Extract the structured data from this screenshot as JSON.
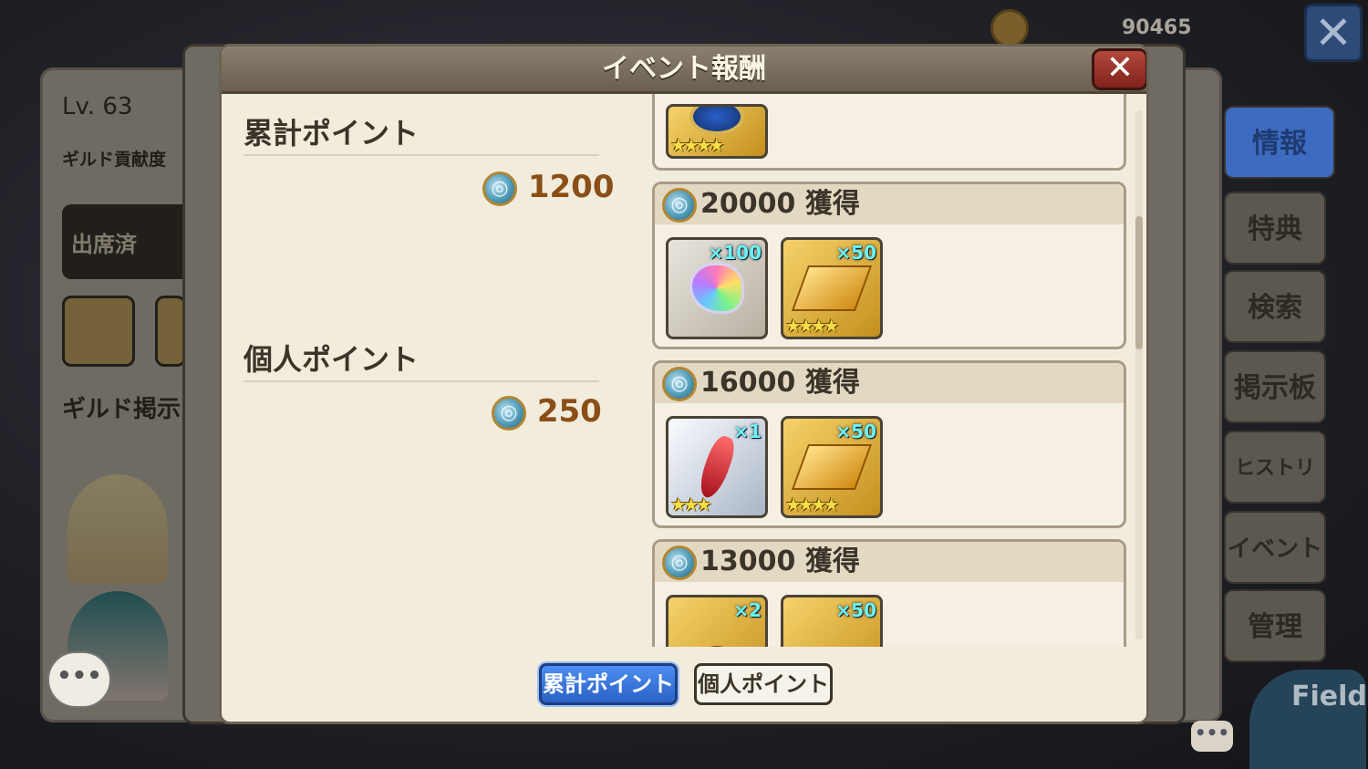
{
  "background": {
    "level": "Lv. 63",
    "guild_contribution": "ギルド貢献度",
    "attendance": "出席済",
    "guild_board": "ギルド掲示",
    "currency_amount": "90465",
    "field_label": "Field",
    "chat_label": "•••",
    "right_menu": [
      {
        "label": "情報",
        "active": true
      },
      {
        "label": "特典",
        "active": false
      },
      {
        "label": "検索",
        "active": false
      },
      {
        "label": "掲示板",
        "active": false
      },
      {
        "label": "ヒストリー",
        "active": false
      },
      {
        "label": "イベント",
        "active": false
      },
      {
        "label": "管理",
        "active": false
      }
    ]
  },
  "dialog": {
    "title": "イベント報酬",
    "close_icon": "✕",
    "cumulative_label": "累計ポイント",
    "cumulative_value": "1200",
    "personal_label": "個人ポイント",
    "personal_value": "250",
    "rewards": [
      {
        "title": "20000 獲得",
        "items": [
          {
            "icon": "rainbow-crystal-icon",
            "count": "×100",
            "stars": 0,
            "bg": "gray"
          },
          {
            "icon": "gold-bars-icon",
            "count": "×50",
            "stars": 4,
            "bg": "gold"
          }
        ]
      },
      {
        "title": "16000 獲得",
        "items": [
          {
            "icon": "red-crystal-icon",
            "count": "×1",
            "stars": 3,
            "bg": "silver"
          },
          {
            "icon": "gold-bars-icon",
            "count": "×50",
            "stars": 4,
            "bg": "gold"
          }
        ]
      },
      {
        "title": "13000 獲得",
        "items": [
          {
            "icon": "gold-pouch-icon",
            "count": "×2",
            "stars": 0,
            "bg": "gold"
          },
          {
            "icon": "gold-bars-icon",
            "count": "×50",
            "stars": 0,
            "bg": "gold"
          }
        ]
      }
    ],
    "tabs": {
      "cumulative": "累計ポイント",
      "personal": "個人ポイント"
    }
  },
  "colors": {
    "accent_blue": "#2b61c4",
    "point_value": "#8a4f16",
    "header_brown": "#6a5f50",
    "close_red": "#b2483d"
  }
}
